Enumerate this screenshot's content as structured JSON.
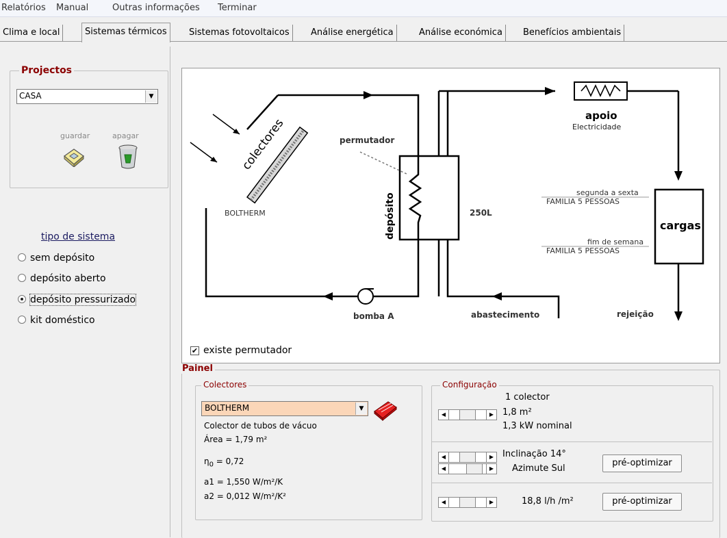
{
  "menu": [
    "Relatórios",
    "Manual",
    "Outras informações",
    "Terminar"
  ],
  "tabs": [
    "Clima e local",
    "Sistemas térmicos",
    "Sistemas fotovoltaicos",
    "Análise energética",
    "Análise económica",
    "Benefícios ambientais"
  ],
  "projectos": {
    "title": "Projectos",
    "selected": "CASA",
    "guardar": "guardar",
    "apagar": "apagar"
  },
  "tipo": {
    "title": "tipo de sistema",
    "options": [
      "sem depósito",
      "depósito aberto",
      "depósito pressurizado",
      "kit doméstico"
    ],
    "selected_index": 2
  },
  "diagram": {
    "colectores": "colectores",
    "boltherm": "BOLTHERM",
    "permutador": "permutador",
    "deposito": "depósito",
    "volume": "250L",
    "apoio": "apoio",
    "electricidade": "Electricidade",
    "seg_sexta": "segunda a sexta",
    "familia1": "FAMILIA 5 PESSOAS",
    "cargas": "cargas",
    "fim_semana": "fim de semana",
    "familia2": "FAMILIA 5 PESSOAS",
    "bomba": "bomba A",
    "abastecimento": "abastecimento",
    "rejeicao": "rejeição",
    "existe_permutador": "existe permutador"
  },
  "painel": {
    "title": "Painel",
    "colectores_title": "Colectores",
    "colector_selected": "BOLTHERM",
    "tipo": "Colector de tubos de vácuo",
    "area": "Área = 1,79 m²",
    "eta": "η",
    "eta_sub": "0",
    "eta_val": " = 0,72",
    "a1": "a1 = 1,550 W/m²/K",
    "a2": "a2 = 0,012 W/m²/K²",
    "config_title": "Configuração",
    "n_colector": "1 colector",
    "area2": "1,8 m²",
    "nominal": "1,3 kW nominal",
    "inclinacao": "Inclinação  14°",
    "azimute": "Azimute  Sul",
    "caudal": "18,8 l/h /m²",
    "pre_opt": "pré-optimizar"
  }
}
